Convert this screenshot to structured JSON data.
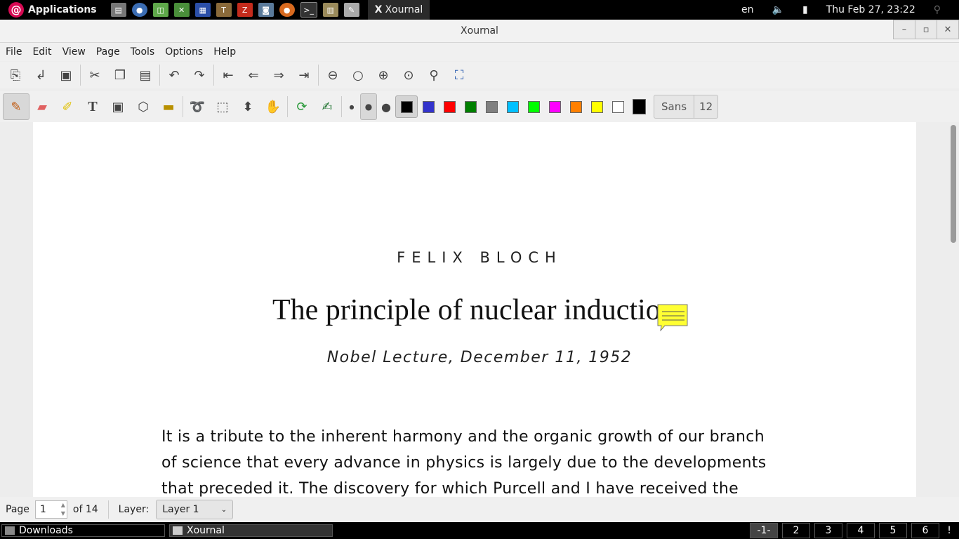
{
  "top_panel": {
    "applications_label": "Applications",
    "launchers": [
      "files-icon",
      "chromium-icon",
      "spreadsheet-icon",
      "settings-icon",
      "calc-icon",
      "tex-icon",
      "filezilla-icon",
      "screenshot-icon",
      "firefox-icon",
      "terminal-icon",
      "archive-icon",
      "xournal-icon"
    ],
    "active_task": "Xournal",
    "keyboard_layout": "en",
    "datetime": "Thu Feb 27, 23:22"
  },
  "window": {
    "title": "Xournal"
  },
  "menu": [
    "File",
    "Edit",
    "View",
    "Page",
    "Tools",
    "Options",
    "Help"
  ],
  "toolbar2": {
    "font_name": "Sans",
    "font_size": "12"
  },
  "colors": [
    "#000000",
    "#3333cc",
    "#ff0000",
    "#008000",
    "#808080",
    "#00c0ff",
    "#00ff00",
    "#ff00ff",
    "#ff8000",
    "#ffff00",
    "#ffffff"
  ],
  "document": {
    "author": "FELIX BLOCH",
    "title": "The principle of nuclear inductio",
    "subtitle": "Nobel Lecture, December 11, 1952",
    "body_lines": [
      "It is a tribute to the inherent harmony and the organic growth of our branch",
      "of science that every advance in physics is largely due to the developments",
      "that preceded it. The discovery for which Purcell and I have received the"
    ]
  },
  "status": {
    "page_label": "Page",
    "page_value": "1",
    "page_total": "of 14",
    "layer_label": "Layer:",
    "layer_value": "Layer 1"
  },
  "bottom_panel": {
    "tasks": [
      "Downloads",
      "Xournal"
    ],
    "workspaces": [
      "-1-",
      "2",
      "3",
      "4",
      "5",
      "6"
    ],
    "notify": "!"
  }
}
